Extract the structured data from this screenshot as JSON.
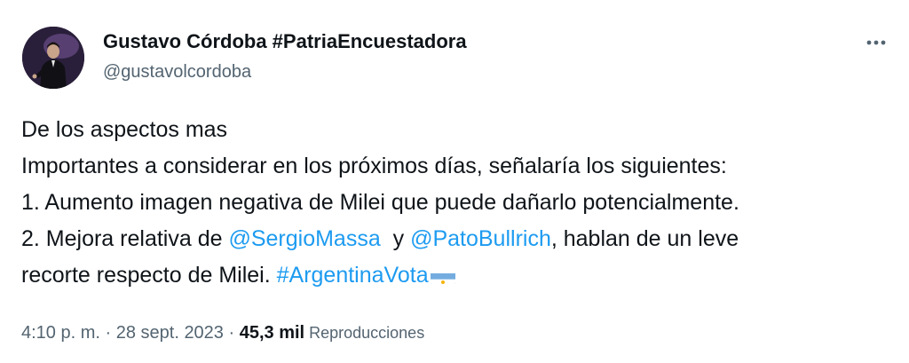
{
  "author": {
    "display_name": "Gustavo Córdoba #PatriaEncuestadora",
    "handle": "@gustavolcordoba"
  },
  "more_icon": "more-horizontal-icon",
  "tweet": {
    "line1": "De los aspectos mas",
    "line2": "Importantes a considerar en los próximos días, señalaría los siguientes:",
    "line3": "1. Aumento imagen negativa de Milei que puede dañarlo potencialmente.",
    "line4_pre": "2. Mejora relativa de ",
    "mention1": "@SergioMassa",
    "line4_mid": "  y ",
    "mention2": "@PatoBullrich",
    "line4_post": ", hablan de un leve",
    "line5_pre": "recorte respecto de Milei. ",
    "hashtag": "#ArgentinaVota",
    "flag_icon": "argentina-flag-icon"
  },
  "meta": {
    "time": "4:10 p. m.",
    "sep1": " · ",
    "date": "28 sept. 2023",
    "sep2": " · ",
    "views_count": "45,3 mil",
    "views_label": " Reproducciones"
  },
  "colors": {
    "text": "#0f1419",
    "secondary": "#536471",
    "link": "#1d9bf0"
  }
}
